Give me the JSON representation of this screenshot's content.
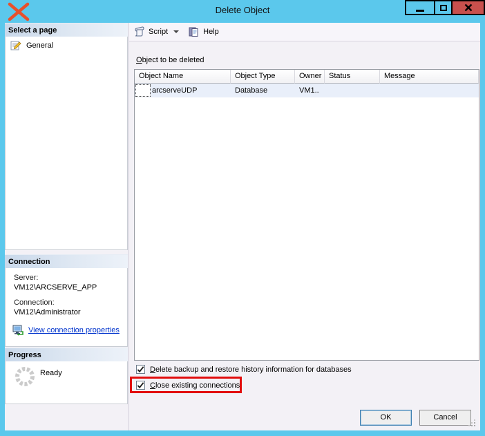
{
  "window": {
    "title": "Delete Object"
  },
  "sidebar": {
    "pages": {
      "header": "Select a page",
      "items": [
        {
          "label": "General"
        }
      ]
    },
    "connection": {
      "header": "Connection",
      "server_label": "Server:",
      "server_value": "VM12\\ARCSERVE_APP",
      "connection_label": "Connection:",
      "connection_value": "VM12\\Administrator",
      "link_label": "View connection properties"
    },
    "progress": {
      "header": "Progress",
      "status": "Ready"
    }
  },
  "toolbar": {
    "script_label": "Script",
    "help_label": "Help"
  },
  "main": {
    "section_label": {
      "mnemonic": "O",
      "rest": "bject to be deleted"
    },
    "table": {
      "columns": [
        "Object Name",
        "Object Type",
        "Owner",
        "Status",
        "Message"
      ],
      "rows": [
        {
          "object_name": "arcserveUDP",
          "object_type": "Database",
          "owner": "VM1..",
          "status": "",
          "message": ""
        }
      ]
    },
    "checkboxes": [
      {
        "mnemonic": "D",
        "rest": "elete backup and restore history information for databases",
        "checked": true,
        "highlighted": false
      },
      {
        "mnemonic": "C",
        "rest": "lose existing connections",
        "checked": true,
        "highlighted": true
      }
    ]
  },
  "footer": {
    "ok_label": "OK",
    "cancel_label": "Cancel"
  },
  "colors": {
    "titlebar_blue": "#5bc8ec",
    "close_button_red": "#c8504d",
    "annotation_box_red": "#e20d0d",
    "annotation_x_orange": "#e8502c",
    "link_blue": "#0033cc",
    "selected_row_blue": "#e9effa"
  }
}
